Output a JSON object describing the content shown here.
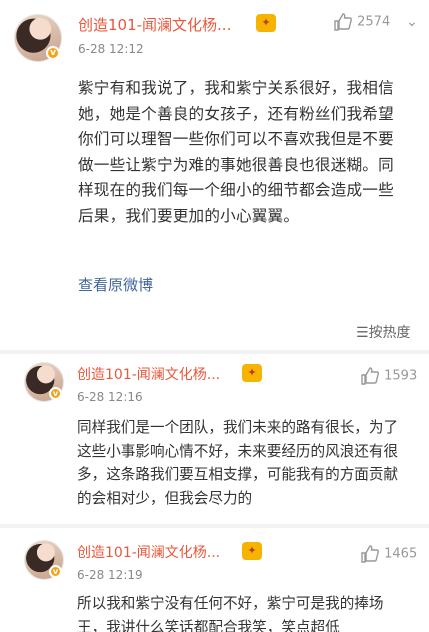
{
  "main_post": {
    "author": "创造101-闻澜文化杨...",
    "badge_icon": "crown-badge-icon",
    "time": "6-28 12:12",
    "likes": "2574",
    "content": "紫宁有和我说了，我和紫宁关系很好，我相信她，她是个善良的女孩子，还有粉丝们我希望你们可以理智一些你们可以不喜欢我但是不要做一些让紫宁为难的事她很善良也很迷糊。同样现在的我们每一个细小的细节都会造成一些后果，我们要更加的小心翼翼。",
    "view_original": "查看原微博"
  },
  "sort": {
    "label": "按热度"
  },
  "comments": [
    {
      "author": "创造101-闻澜文化杨...",
      "time": "6-28 12:16",
      "likes": "1593",
      "content": "同样我们是一个团队，我们未来的路有很长，为了这些小事影响心情不好，未来要经历的风浪还有很多，这条路我们要互相支撑，可能我有的方面贡献的会相对少，但我会尽力的"
    },
    {
      "author": "创造101-闻澜文化杨...",
      "time": "6-28 12:19",
      "likes": "1465",
      "content": "所以我和紫宁没有任何不好，紫宁可是我的捧场王，我讲什么笑话都配合我笑，笑点超低"
    }
  ],
  "colors": {
    "name": "#e8583b",
    "link": "#40669b",
    "text": "#333333",
    "muted": "#999999"
  }
}
